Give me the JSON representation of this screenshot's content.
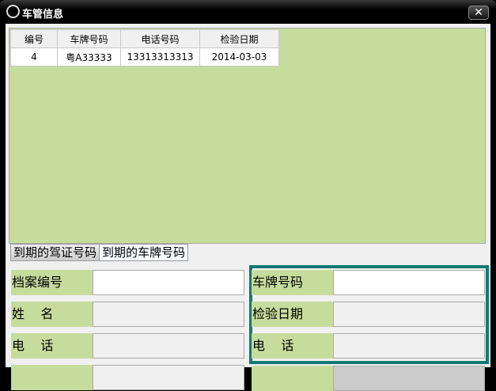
{
  "window": {
    "title": "车管信息",
    "close": "✕"
  },
  "table": {
    "headers": [
      "编号",
      "车牌号码",
      "电话号码",
      "检验日期"
    ],
    "rows": [
      [
        "4",
        "粤A33333",
        "13313313313",
        "2014-03-03"
      ]
    ]
  },
  "tabs": [
    "到期的驾证号码",
    "到期的车牌号码"
  ],
  "form": {
    "left": [
      {
        "label": "档案编号",
        "value": ""
      },
      {
        "label": "姓    名",
        "value": ""
      },
      {
        "label": "电    话",
        "value": ""
      }
    ],
    "right": [
      {
        "label": "车牌号码",
        "value": ""
      },
      {
        "label": "检验日期",
        "value": ""
      },
      {
        "label": "电    话",
        "value": ""
      }
    ]
  }
}
